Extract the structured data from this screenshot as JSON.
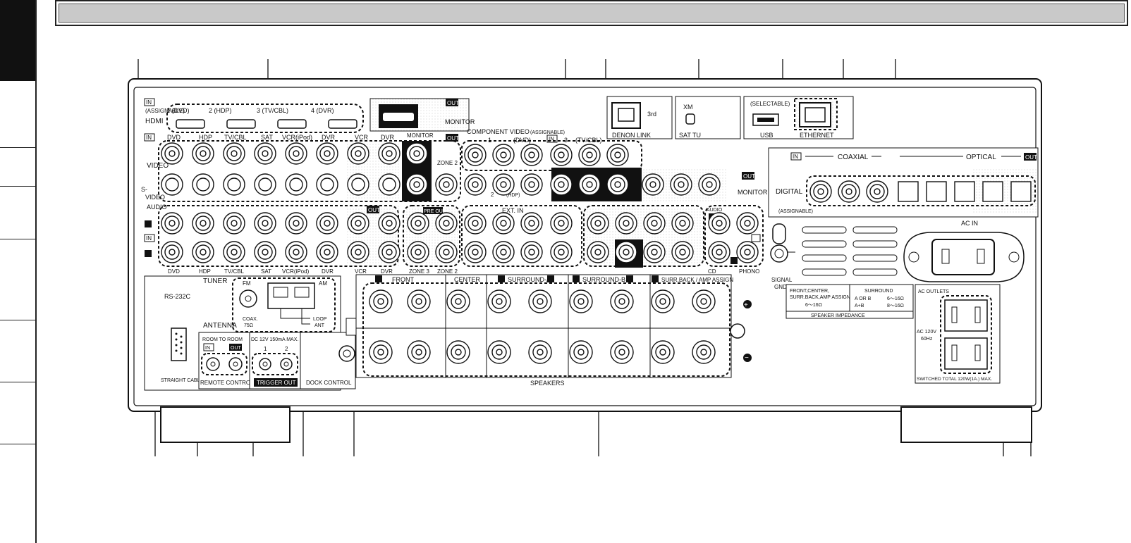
{
  "panel": {
    "hdmi": {
      "in_badge": "IN",
      "assignable": "(ASSIGNABLE)",
      "label": "HDMI",
      "inputs": [
        "1 (DVD)",
        "2 (HDP)",
        "3 (TV/CBL)",
        "4 (DVR)"
      ],
      "out_badge": "OUT",
      "monitor": "MONITOR"
    },
    "denon_link": {
      "label": "DENON LINK",
      "third": "3rd"
    },
    "sat_tu": {
      "xm": "XM",
      "label": "SAT TU"
    },
    "usb": {
      "selectable": "(SELECTABLE)",
      "label": "USB"
    },
    "ethernet": {
      "label": "ETHERNET"
    },
    "video": {
      "label": "VIDEO",
      "svideo": "S-\nVIDEO",
      "in_badge": "IN",
      "out_badge": "OUT",
      "labels": [
        "DVD",
        "HDP",
        "TV/CBL",
        "SAT",
        "VCR(iPod)",
        "DVR",
        "VCR",
        "DVR",
        "MONITOR"
      ],
      "zone2": "ZONE 2"
    },
    "component": {
      "title": "COMPONENT VIDEO",
      "assignable": "(ASSIGNABLE)",
      "in_badge": "IN",
      "inputs": [
        "1",
        "(DVD)",
        "3",
        "(TV/CBL)"
      ],
      "row_labels": [
        "Y",
        "PB/CB",
        "PR/CR",
        "Y",
        "PB/CB",
        "PR/CR",
        "Y",
        "PB/CB",
        "PR/CR"
      ],
      "input2": "2",
      "hdp": "(HDP)",
      "monitor_out": "OUT",
      "monitor": "MONITOR"
    },
    "digital": {
      "in_badge": "IN",
      "coaxial": "COAXIAL",
      "optical": "OPTICAL",
      "out_badge": "OUT",
      "label": "DIGITAL",
      "assignable": "(ASSIGNABLE)",
      "labels": [
        "1 (DVD)",
        "2 (TV/CBL)",
        "3 (CD)",
        "1 (SAT)",
        "2 (DVR)",
        "3 (VCR)",
        "2 (DVR)",
        "3 (VCR)"
      ]
    },
    "audio": {
      "label": "AUDIO",
      "in_badge": "IN",
      "out_badge": "OUT",
      "pre_out": "PRE OUT",
      "labels": [
        "DVD",
        "HDP",
        "TV/CBL",
        "SAT",
        "VCR(iPod)",
        "DVR",
        "VCR",
        "DVR",
        "ZONE 3",
        "ZONE 2",
        "FL",
        "SW",
        "SL",
        "SBL",
        "FR",
        "C",
        "SR",
        "SBR",
        "FR",
        "SW",
        "SR",
        "SBR"
      ],
      "ext_in": "EXT. IN",
      "cd": "CD",
      "phono": "PHONO",
      "audio_small": "AUDIO"
    },
    "ac_in": "AC IN",
    "signal_gnd": "SIGNAL\nGND",
    "tuner": {
      "label": "TUNER",
      "fm": "FM",
      "am": "AM",
      "antenna": "ANTENNA",
      "coax": "COAX.\n75Ω",
      "loop": "LOOP\nANT"
    },
    "rs232c": {
      "label": "RS-232C",
      "cable": "STRAIGHT CABLE"
    },
    "room_to_room": {
      "title": "ROOM TO ROOM",
      "in_badge": "IN",
      "out_badge": "OUT",
      "label": "REMOTE CONTROL"
    },
    "trigger": {
      "title": "DC 12V 150mA MAX.",
      "ports": [
        "1",
        "2"
      ],
      "label": "TRIGGER OUT"
    },
    "dock": "DOCK CONTROL",
    "speakers": {
      "label": "SPEAKERS",
      "groups": [
        "FRONT",
        "CENTER",
        "SURROUND-A",
        "SURROUND-B",
        "SURR.BACK / AMP ASSIGN"
      ]
    },
    "impedance": {
      "col1": "FRONT,CENTER,\nSURR.BACK,AMP ASSIGN\n6～16Ω",
      "surround": "SURROUND",
      "a_or_b": "A OR B",
      "ab": "A+B",
      "v1": "6～16Ω",
      "v2": "8～16Ω",
      "label": "SPEAKER IMPEDANCE"
    },
    "ac_outlets": {
      "label": "AC OUTLETS",
      "voltage": "AC 120V\n60Hz",
      "switched": "SWITCHED TOTAL 120W(1A.) MAX."
    },
    "plus": "+",
    "minus": "−"
  }
}
